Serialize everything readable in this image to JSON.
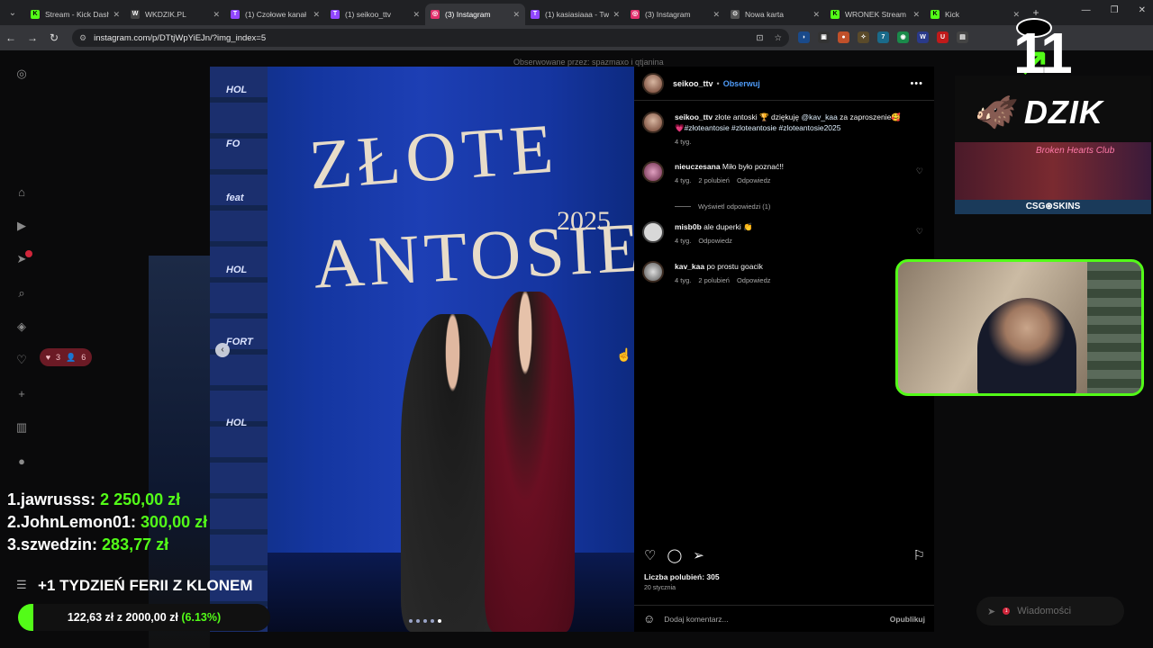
{
  "browser": {
    "tabs": [
      {
        "title": "Stream - Kick Dash",
        "fav": "K",
        "color": "#53fc18",
        "active": false
      },
      {
        "title": "WKDZIK.PL",
        "fav": "W",
        "color": "#444",
        "active": false
      },
      {
        "title": "(1) Czołowe kanał",
        "fav": "T",
        "color": "#9146ff",
        "active": false
      },
      {
        "title": "(1) seikoo_ttv",
        "fav": "T",
        "color": "#9146ff",
        "active": false
      },
      {
        "title": "(3) Instagram",
        "fav": "◎",
        "color": "#e1306c",
        "active": true
      },
      {
        "title": "(1) kasiasiaaa - Tw",
        "fav": "T",
        "color": "#9146ff",
        "active": false
      },
      {
        "title": "(3) Instagram",
        "fav": "◎",
        "color": "#e1306c",
        "active": false
      },
      {
        "title": "Nowa karta",
        "fav": "⊙",
        "color": "#555",
        "active": false
      },
      {
        "title": "WRONEK Stream",
        "fav": "K",
        "color": "#53fc18",
        "active": false
      },
      {
        "title": "Kick",
        "fav": "K",
        "color": "#53fc18",
        "active": false
      }
    ],
    "url": "instagram.com/p/DTtjWpYiEJn/?img_index=5"
  },
  "instagram": {
    "observed_by": "Obserwowane przez: spazmaxo i qtjanina",
    "notif_pill": {
      "likes": "3",
      "followers": "6"
    },
    "post_owner": "seikoo_ttv",
    "separator": "•",
    "follow_label": "Obserwuj",
    "caption": {
      "user": "seikoo_ttv",
      "text": " złote antoski 🏆 dziękuję ",
      "mention": "@kav_kaa",
      "text2": " za zaproszenie🥰",
      "hashtags": "💗#złoteantosie #zloteantosie #zloteantosie2025",
      "time": "4 tyg."
    },
    "comments": [
      {
        "user": "nieuczesana",
        "text": " Miło było poznać!!",
        "time": "4 tyg.",
        "likes": "2 polubień",
        "reply": "Odpowiedz"
      },
      {
        "user": "misb0b",
        "text": " ale duperki 👏",
        "time": "4 tyg.",
        "likes": "",
        "reply": "Odpowiedz"
      },
      {
        "user": "kav_kaa",
        "text": " po prostu goacik",
        "time": "4 tyg.",
        "likes": "2 polubień",
        "reply": "Odpowiedz"
      }
    ],
    "view_replies": "Wyświetl odpowiedzi (1)",
    "likes_count": "Liczba polubień: 305",
    "date": "20 stycznia",
    "add_comment_placeholder": "Dodaj komentarz...",
    "post_label": "Opublikuj",
    "photo_text": {
      "line1": "ZŁOTE",
      "line2": "ANTOSIE",
      "year": "2025"
    },
    "messages_label": "Wiadomości",
    "messages_badge": "1"
  },
  "stream": {
    "counter": "11",
    "dzik_logo": "DZIK",
    "banner_text": "Broken Hearts Club",
    "sponsor": "CSG⊛SKINS",
    "leaderboard": [
      {
        "rank": "1.",
        "name": "jawrusss:",
        "amount": "2 250,00 zł"
      },
      {
        "rank": "2.",
        "name": "JohnLemon01:",
        "amount": "300,00 zł"
      },
      {
        "rank": "3.",
        "name": "szwedzin:",
        "amount": "283,77 zł"
      }
    ],
    "goal_title": "+1 TYDZIEŃ FERII Z KLONEM",
    "goal_current": "122,63 zł",
    "goal_sep": " z ",
    "goal_target": "2000,00 zł",
    "goal_percent": "(6.13%)",
    "goal_fraction": 0.0613
  }
}
